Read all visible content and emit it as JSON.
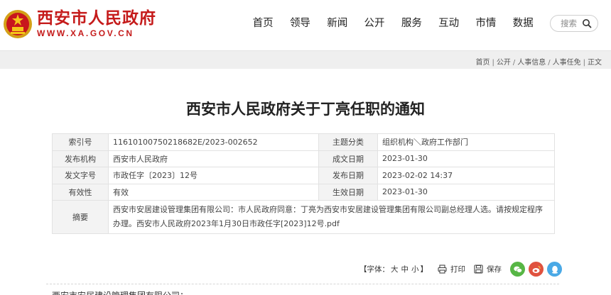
{
  "header": {
    "site_name": "西安市人民政府",
    "site_url": "WWW.XA.GOV.CN",
    "search_placeholder": "搜索"
  },
  "nav": [
    "首页",
    "领导",
    "新闻",
    "公开",
    "服务",
    "互动",
    "市情",
    "数据"
  ],
  "breadcrumb": [
    "首页",
    "公开",
    "人事信息",
    "人事任免",
    "正文"
  ],
  "article": {
    "title": "西安市人民政府关于丁亮任职的通知",
    "meta": {
      "index_label": "索引号",
      "index_value": "11610100750218682E/2023-002652",
      "category_label": "主题分类",
      "category_value": "组织机构＼政府工作部门",
      "publisher_label": "发布机构",
      "publisher_value": "西安市人民政府",
      "created_label": "成文日期",
      "created_value": "2023-01-30",
      "docno_label": "发文字号",
      "docno_value": "市政任字〔2023〕12号",
      "released_label": "发布日期",
      "released_value": "2023-02-02 14:37",
      "validity_label": "有效性",
      "validity_value": "有效",
      "effective_label": "生效日期",
      "effective_value": "2023-01-30",
      "abstract_label": "摘要",
      "abstract_value": "西安市安居建设管理集团有限公司：市人民政府同意：丁亮为西安市安居建设管理集团有限公司副总经理人选。请按规定程序办理。西安市人民政府2023年1月30日市政任字[2023]12号.pdf"
    },
    "tools": {
      "font_label": "【字体：",
      "font_large": "大",
      "font_medium": "中",
      "font_small": "小",
      "font_end": "】",
      "print_label": "打印",
      "save_label": "保存"
    },
    "body_start": "西安市安居建设管理集团有限公司："
  },
  "colors": {
    "brand_red": "#c51b1b",
    "wechat": "#57b645",
    "weibo": "#e0523f",
    "qq": "#4aa9e6"
  }
}
